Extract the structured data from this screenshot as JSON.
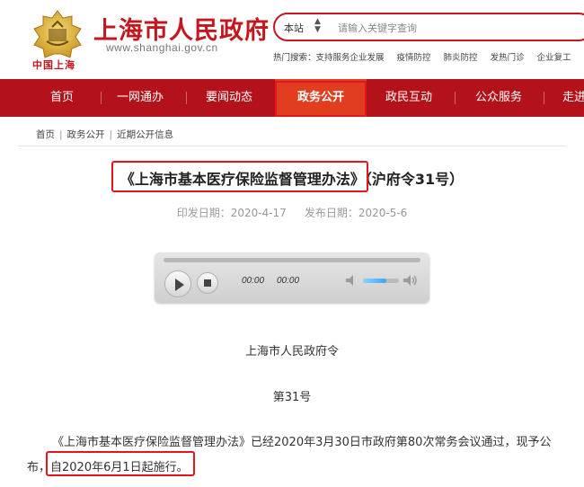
{
  "header": {
    "site_title": "上海市人民政府",
    "domain": "www.shanghai.gov.cn",
    "logo_sub": "中国上海"
  },
  "search": {
    "scope": "本站",
    "placeholder": "请输入关键字查询",
    "hot_label": "热门搜索：",
    "hot_items": [
      "支持服务企业发展",
      "疫情防控",
      "肺炎防控",
      "发热门诊",
      "企业复工"
    ]
  },
  "nav": {
    "items": [
      "首页",
      "一网通办",
      "要闻动态",
      "政务公开",
      "政民互动",
      "公众服务",
      "走进"
    ],
    "active_index": 3
  },
  "breadcrumb": [
    "首页",
    "政务公开",
    "近期公开信息"
  ],
  "doc": {
    "title": "《上海市基本医疗保险监督管理办法》（沪府令31号）",
    "issue_label": "印发日期：2020-4-17",
    "publish_label": "发布日期：2020-5-6",
    "issuer": "上海市人民政府令",
    "order_no": "第31号",
    "para_line1": "《上海市基本医疗保险监督管理办法》已经2020年3月30日市政府第80次常务会议通过，现予公",
    "para_line2_prefix": "布，",
    "para_line2_highlight": "自2020年6月1日起施行。"
  },
  "player": {
    "time_current": "00:00",
    "time_total": "00:00",
    "volume_fraction": 0.65
  },
  "colors": {
    "brand_red": "#c4161c",
    "nav_bg": "#b3121a",
    "nav_active": "#e03e1f",
    "annotation_red": "#e8141c"
  }
}
